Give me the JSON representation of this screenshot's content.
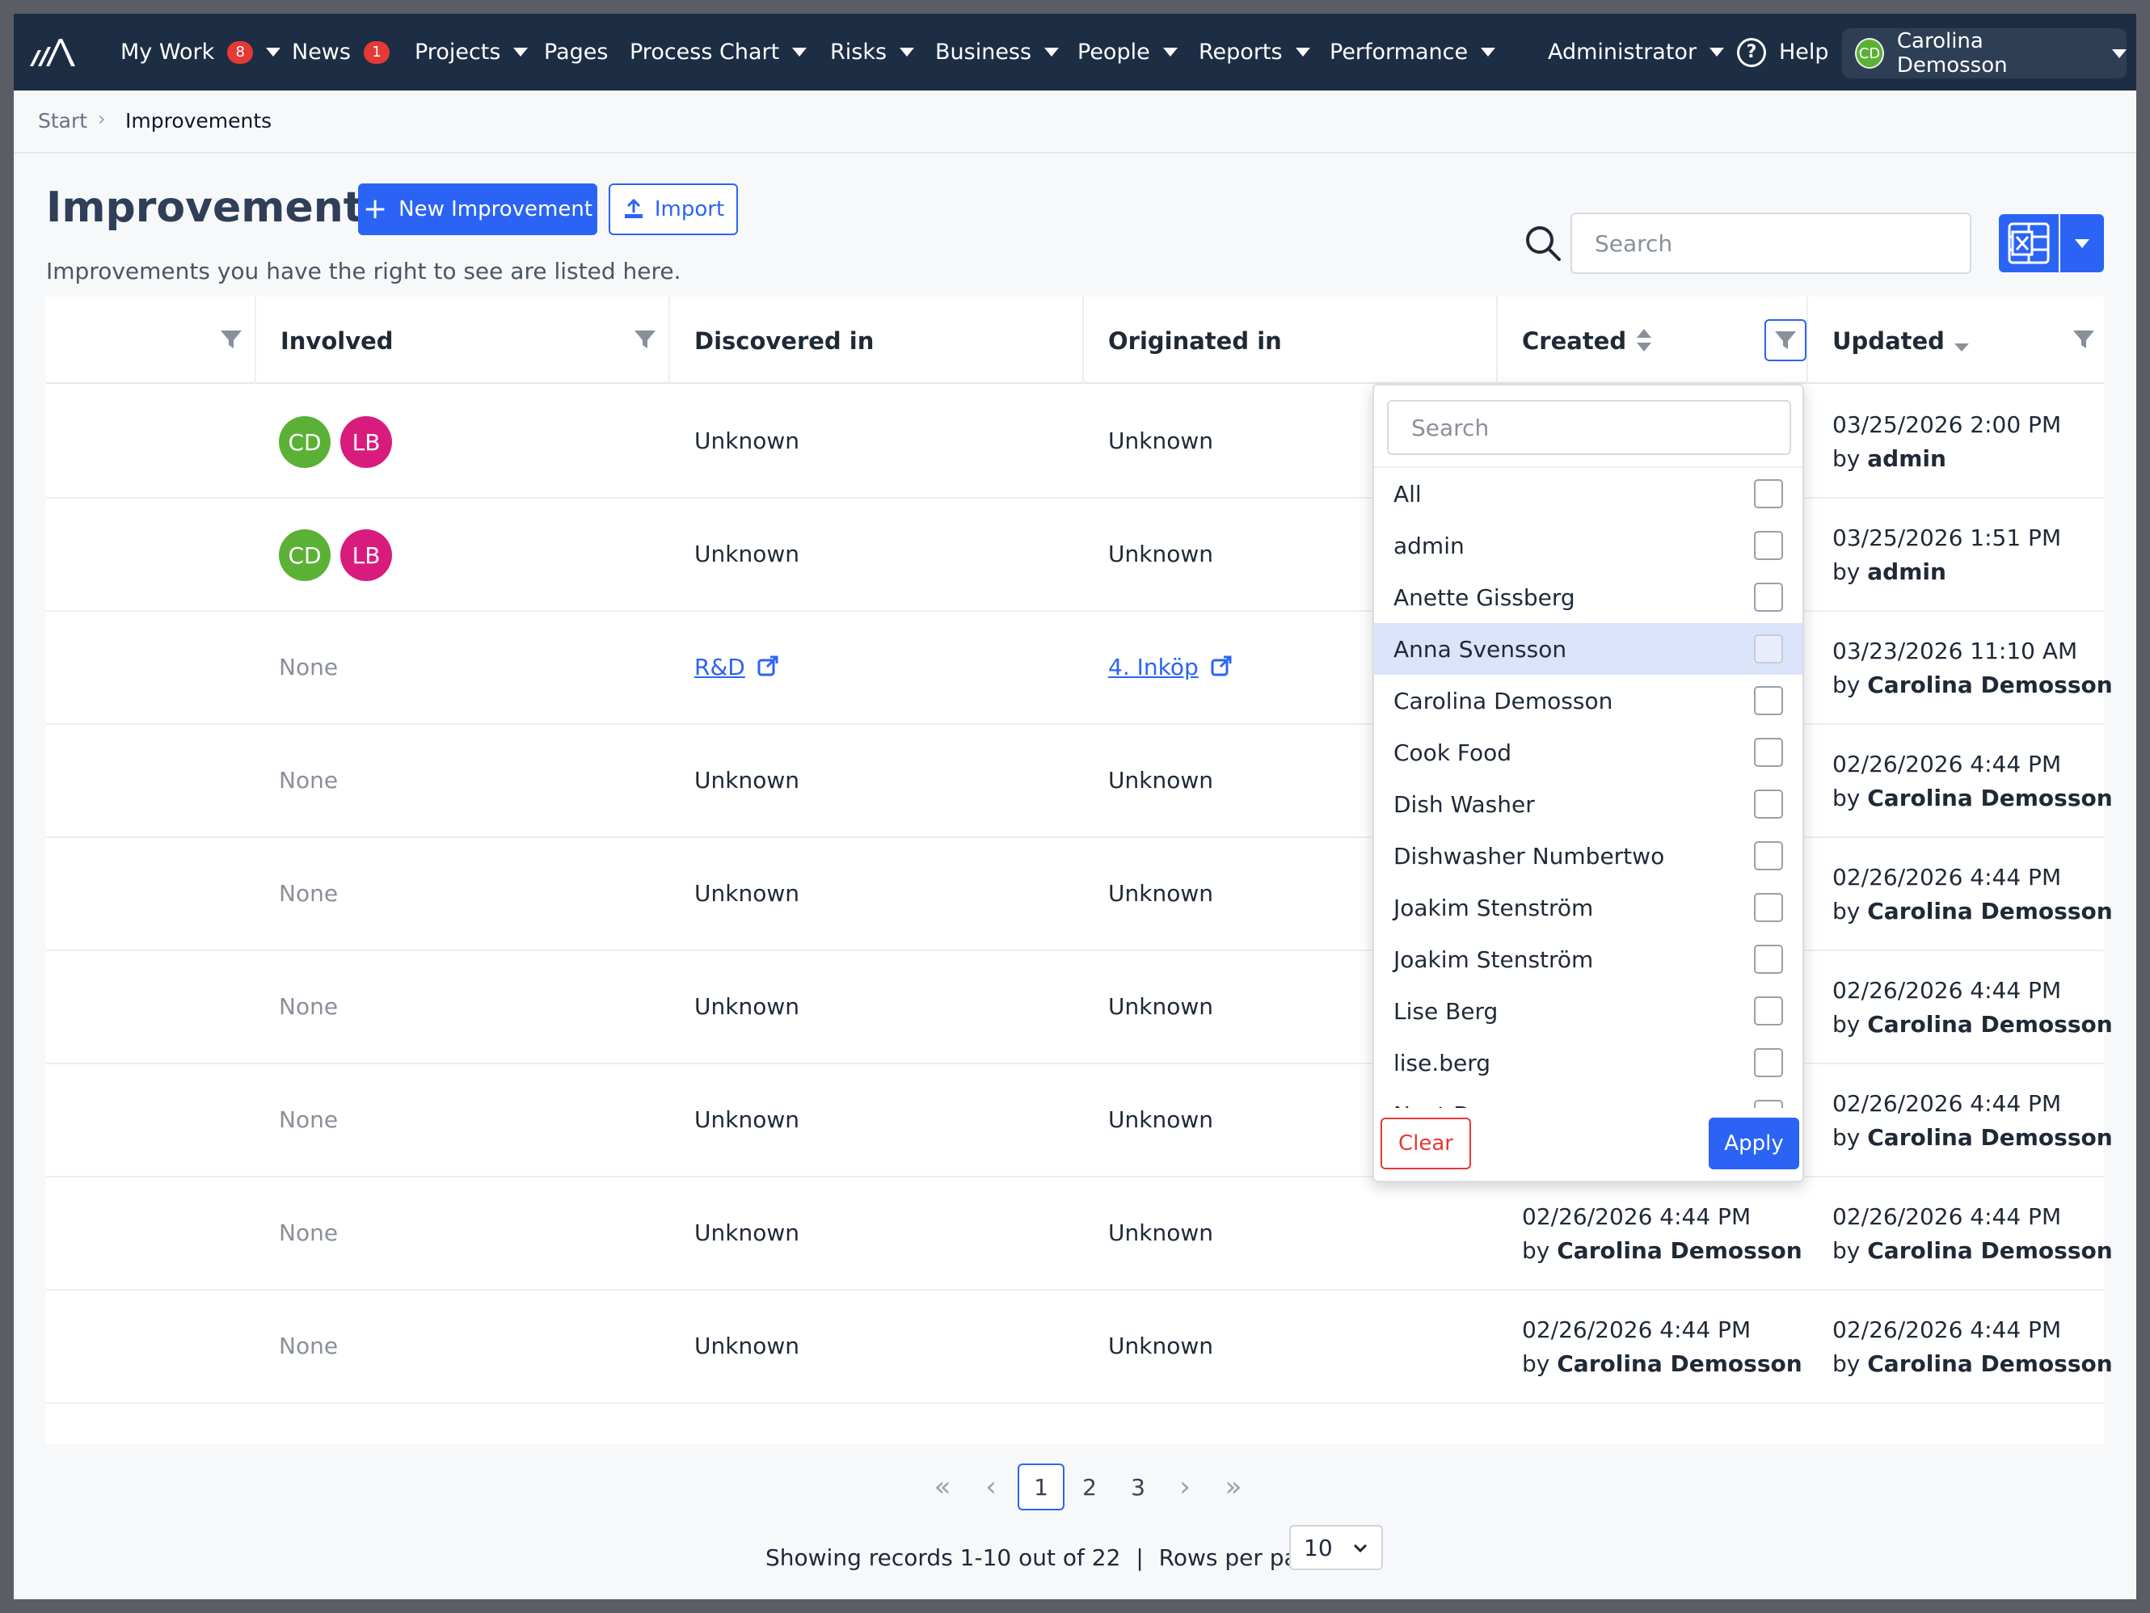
{
  "nav": {
    "items": [
      {
        "label": "My Work",
        "badge": "8",
        "caret": true
      },
      {
        "label": "News",
        "badge": "1",
        "caret": false
      },
      {
        "label": "Projects",
        "badge": null,
        "caret": true
      },
      {
        "label": "Pages",
        "badge": null,
        "caret": false
      },
      {
        "label": "Process Chart",
        "badge": null,
        "caret": true
      },
      {
        "label": "Risks",
        "badge": null,
        "caret": true
      },
      {
        "label": "Business",
        "badge": null,
        "caret": true
      },
      {
        "label": "People",
        "badge": null,
        "caret": true
      },
      {
        "label": "Reports",
        "badge": null,
        "caret": true
      },
      {
        "label": "Performance",
        "badge": null,
        "caret": true
      }
    ],
    "admin_label": "Administrator",
    "help_label": "Help",
    "user_initials": "CD",
    "user_name": "Carolina Demosson"
  },
  "breadcrumb": {
    "start": "Start",
    "current": "Improvements"
  },
  "page": {
    "title": "Improvements",
    "subtitle": "Improvements you have the right to see are listed here.",
    "new_button": "New Improvement",
    "import_button": "Import",
    "search_placeholder": "Search"
  },
  "table": {
    "columns": {
      "involved": "Involved",
      "discovered": "Discovered in",
      "originated": "Originated in",
      "created": "Created",
      "updated": "Updated"
    },
    "rows": [
      {
        "involved": [
          "CD",
          "LB"
        ],
        "discovered": "Unknown",
        "discovered_link": false,
        "originated": "Unknown",
        "originated_link": false,
        "created_date": "",
        "created_by": "",
        "updated_date": "03/25/2026 2:00 PM",
        "updated_by": "admin"
      },
      {
        "involved": [
          "CD",
          "LB"
        ],
        "discovered": "Unknown",
        "discovered_link": false,
        "originated": "Unknown",
        "originated_link": false,
        "created_date": "",
        "created_by": "",
        "updated_date": "03/25/2026 1:51 PM",
        "updated_by": "admin"
      },
      {
        "involved": "None",
        "discovered": "R&D",
        "discovered_link": true,
        "originated": "4. Inköp",
        "originated_link": true,
        "created_date": "",
        "created_by": "",
        "updated_date": "03/23/2026 11:10 AM",
        "updated_by": "Carolina Demosson"
      },
      {
        "involved": "None",
        "discovered": "Unknown",
        "discovered_link": false,
        "originated": "Unknown",
        "originated_link": false,
        "created_date": "",
        "created_by": "",
        "updated_date": "02/26/2026 4:44 PM",
        "updated_by": "Carolina Demosson"
      },
      {
        "involved": "None",
        "discovered": "Unknown",
        "discovered_link": false,
        "originated": "Unknown",
        "originated_link": false,
        "created_date": "",
        "created_by": "",
        "updated_date": "02/26/2026 4:44 PM",
        "updated_by": "Carolina Demosson"
      },
      {
        "involved": "None",
        "discovered": "Unknown",
        "discovered_link": false,
        "originated": "Unknown",
        "originated_link": false,
        "created_date": "",
        "created_by": "",
        "updated_date": "02/26/2026 4:44 PM",
        "updated_by": "Carolina Demosson"
      },
      {
        "involved": "None",
        "discovered": "Unknown",
        "discovered_link": false,
        "originated": "Unknown",
        "originated_link": false,
        "created_date": "",
        "created_by": "",
        "updated_date": "02/26/2026 4:44 PM",
        "updated_by": "Carolina Demosson"
      },
      {
        "involved": "None",
        "discovered": "Unknown",
        "discovered_link": false,
        "originated": "Unknown",
        "originated_link": false,
        "created_date": "02/26/2026 4:44 PM",
        "created_by": "Carolina Demosson",
        "updated_date": "02/26/2026 4:44 PM",
        "updated_by": "Carolina Demosson"
      },
      {
        "involved": "None",
        "discovered": "Unknown",
        "discovered_link": false,
        "originated": "Unknown",
        "originated_link": false,
        "created_date": "02/26/2026 4:44 PM",
        "created_by": "Carolina Demosson",
        "updated_date": "02/26/2026 4:44 PM",
        "updated_by": "Carolina Demosson"
      }
    ],
    "by_prefix": "by"
  },
  "filter_dropdown": {
    "search_placeholder": "Search",
    "options": [
      "All",
      "admin",
      "Anette Gissberg",
      "Anna Svensson",
      "Carolina Demosson",
      "Cook Food",
      "Dish Washer",
      "Dishwasher Numbertwo",
      "Joakim Stenström",
      "Joakim Stenström",
      "Lise Berg",
      "lise.berg",
      "Next Demo"
    ],
    "highlighted": "Anna Svensson",
    "clear_label": "Clear",
    "apply_label": "Apply"
  },
  "pagination": {
    "pages": [
      "1",
      "2",
      "3"
    ],
    "current_page": "1",
    "records_text": "Showing records 1-10 out of 22",
    "separator": "|",
    "rows_per_page_label": "Rows per page:",
    "rows_per_page_value": "10"
  },
  "colors": {
    "accent": "#2b64f5",
    "nav_bg": "#1d2d44",
    "danger": "#e53935",
    "avatar_cd": "#5bb136",
    "avatar_lb": "#d81b7c"
  }
}
